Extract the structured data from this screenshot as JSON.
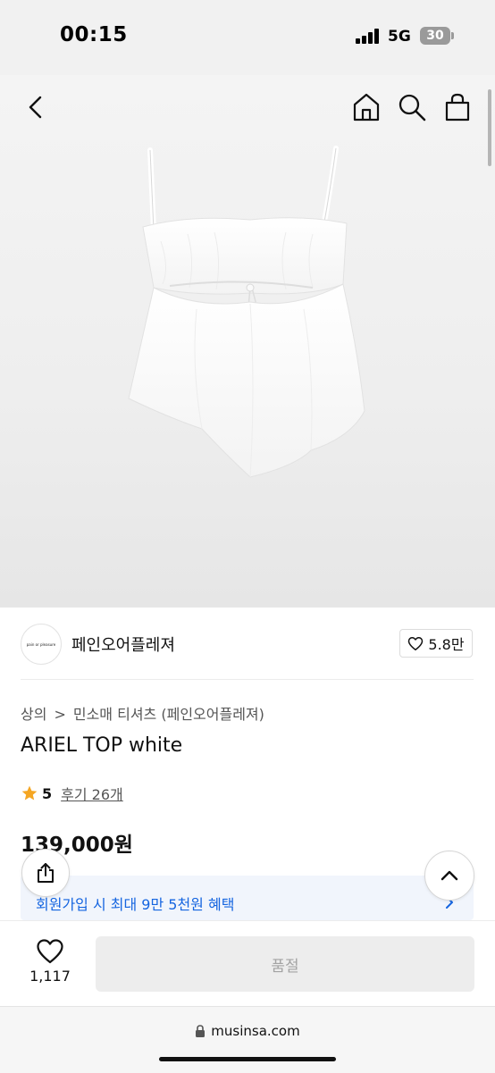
{
  "status": {
    "time": "00:15",
    "network": "5G",
    "battery": "30"
  },
  "header": {
    "back_icon": "back-icon",
    "home_icon": "home-icon",
    "search_icon": "search-icon",
    "bag_icon": "bag-icon"
  },
  "brand": {
    "logo_text": "pain or pleasure",
    "name": "페인오어플레져",
    "likes": "5.8만"
  },
  "breadcrumb": {
    "level1": "상의",
    "separator": ">",
    "level2": "민소매 티셔츠 (페인오어플레져)"
  },
  "product": {
    "title": "ARIEL TOP white",
    "rating": "5",
    "reviews": "후기 26개",
    "price": "139,000원"
  },
  "promo": {
    "text": "회원가입 시 최대 9만 5천원 혜택"
  },
  "bottom": {
    "wish_count": "1,117",
    "buy_label": "품절"
  },
  "browser": {
    "url": "musinsa.com"
  },
  "colors": {
    "promo_text": "#1565e0",
    "star": "#f5a623",
    "soldout_bg": "#ededed"
  }
}
